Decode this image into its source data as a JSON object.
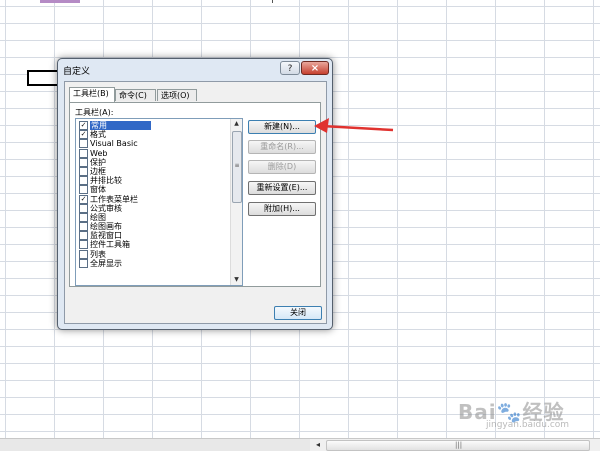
{
  "dialog": {
    "title": "自定义",
    "help_label": "?",
    "close_label": "×",
    "tabs": [
      {
        "label": "工具栏(B)",
        "active": true
      },
      {
        "label": "命令(C)",
        "active": false
      },
      {
        "label": "选项(O)",
        "active": false
      }
    ],
    "toolbars_label": "工具栏(A):",
    "toolbars": [
      {
        "label": "常用",
        "checked": true,
        "selected": true
      },
      {
        "label": "格式",
        "checked": true,
        "selected": false
      },
      {
        "label": "Visual Basic",
        "checked": false,
        "selected": false
      },
      {
        "label": "Web",
        "checked": false,
        "selected": false
      },
      {
        "label": "保护",
        "checked": false,
        "selected": false
      },
      {
        "label": "边框",
        "checked": false,
        "selected": false
      },
      {
        "label": "并排比较",
        "checked": false,
        "selected": false
      },
      {
        "label": "窗体",
        "checked": false,
        "selected": false
      },
      {
        "label": "工作表菜单栏",
        "checked": true,
        "selected": false
      },
      {
        "label": "公式审核",
        "checked": false,
        "selected": false
      },
      {
        "label": "绘图",
        "checked": false,
        "selected": false
      },
      {
        "label": "绘图画布",
        "checked": false,
        "selected": false
      },
      {
        "label": "监视窗口",
        "checked": false,
        "selected": false
      },
      {
        "label": "控件工具箱",
        "checked": false,
        "selected": false
      },
      {
        "label": "列表",
        "checked": false,
        "selected": false
      },
      {
        "label": "全屏显示",
        "checked": false,
        "selected": false
      }
    ],
    "buttons": {
      "new": "新建(N)...",
      "rename": "重命名(R)...",
      "delete": "删除(D)",
      "reset": "重新设置(E)...",
      "attach": "附加(H)..."
    },
    "close_button": "关闭",
    "check_mark": "✓"
  },
  "watermark": {
    "brand": "Bai",
    "brand2": "经验",
    "url": "jingyan.baidu.com"
  },
  "colors": {
    "accent_arrow": "#e0322f",
    "selection": "#3168c6"
  }
}
